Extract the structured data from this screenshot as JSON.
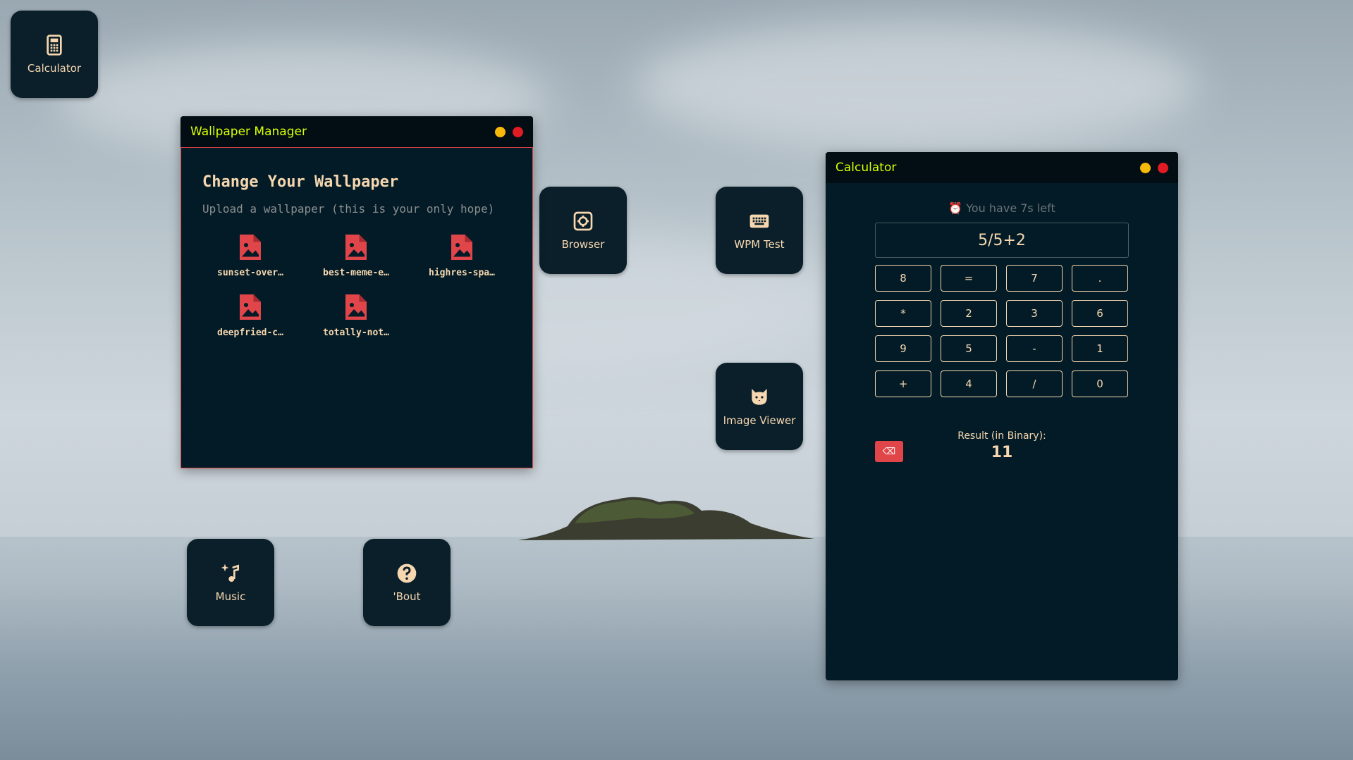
{
  "desktop": {
    "icons": [
      {
        "label": "Calculator",
        "icon": "calculator-icon"
      },
      {
        "label": "Browser",
        "icon": "settings-gear-icon"
      },
      {
        "label": "WPM Test",
        "icon": "keyboard-icon"
      },
      {
        "label": "Image Viewer",
        "icon": "cat-icon"
      },
      {
        "label": "Music",
        "icon": "music-note-icon"
      },
      {
        "label": "'Bout",
        "icon": "help-icon"
      }
    ]
  },
  "wallpaper_window": {
    "title": "Wallpaper Manager",
    "heading": "Change Your Wallpaper",
    "subheading": "Upload a wallpaper (this is your only hope)",
    "files": [
      "sunset-over…",
      "best-meme-e…",
      "highres-spa…",
      "deepfried-c…",
      "totally-not…"
    ]
  },
  "calculator_window": {
    "title": "Calculator",
    "timer_text": "You have 7s left",
    "expression": "5/5+2",
    "buttons": [
      "8",
      "=",
      "7",
      ".",
      "*",
      "2",
      "3",
      "6",
      "9",
      "5",
      "-",
      "1",
      "+",
      "4",
      "/",
      "0"
    ],
    "result_label": "Result (in Binary):",
    "result_value": "11",
    "backspace_icon": "backspace-icon"
  },
  "colors": {
    "accent_title": "#d7ff00",
    "text": "#f6d7b0",
    "window_bg": "#021b26",
    "file_icon": "#e0454a"
  }
}
